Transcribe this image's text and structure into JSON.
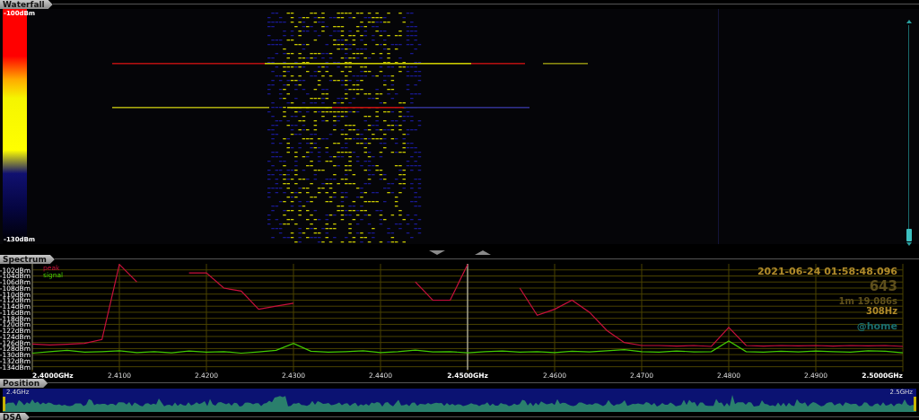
{
  "waterfall": {
    "title": "Waterfall",
    "scale_top": "-100dBm",
    "scale_bottom": "-130dBm"
  },
  "spectrum": {
    "title": "Spectrum",
    "info": [
      {
        "kind": "timestamp",
        "text": "2021-06-24 01:58:48.096"
      },
      {
        "kind": "count",
        "text": "643"
      },
      {
        "kind": "elapsed",
        "text": "1m 19.086s"
      },
      {
        "kind": "resolution",
        "text": "308Hz"
      },
      {
        "kind": "location",
        "text": "@home"
      }
    ],
    "chart_data": {
      "type": "line",
      "x": [
        2.4,
        2.402,
        2.404,
        2.406,
        2.408,
        2.41,
        2.412,
        2.414,
        2.416,
        2.418,
        2.42,
        2.422,
        2.424,
        2.426,
        2.428,
        2.43,
        2.432,
        2.434,
        2.436,
        2.438,
        2.44,
        2.442,
        2.444,
        2.446,
        2.448,
        2.45,
        2.452,
        2.454,
        2.456,
        2.458,
        2.46,
        2.462,
        2.464,
        2.466,
        2.468,
        2.47,
        2.472,
        2.474,
        2.476,
        2.478,
        2.48,
        2.482,
        2.484,
        2.486,
        2.488,
        2.49,
        2.492,
        2.494,
        2.496,
        2.498,
        2.5
      ],
      "series": [
        {
          "name": "peak",
          "color": "#c8103c",
          "values": [
            -126.5,
            -126.8,
            -126.6,
            -126.3,
            -125,
            -100.2,
            -106,
            null,
            null,
            -103,
            -103,
            -108,
            -109,
            -115,
            -114,
            -113,
            null,
            null,
            null,
            null,
            null,
            null,
            -106,
            -112,
            -112,
            -100.2,
            null,
            null,
            -108,
            -117,
            -115,
            -112,
            -116,
            -122,
            -126,
            -127,
            -127,
            -127.2,
            -127,
            -127.3,
            -121,
            -127,
            -127.2,
            -127,
            -127.1,
            -127,
            -127.2,
            -127,
            -127.1,
            -127,
            -127.3
          ]
        },
        {
          "name": "signal",
          "color": "#44cc00",
          "values": [
            -129.5,
            -129,
            -128.6,
            -129.2,
            -129,
            -128.7,
            -129.3,
            -129,
            -129.4,
            -128.8,
            -129.2,
            -129,
            -129.5,
            -129.1,
            -128.6,
            -126.3,
            -128.9,
            -129.2,
            -129,
            -128.7,
            -129.3,
            -129,
            -128.5,
            -129.1,
            -129,
            -129.4,
            -129,
            -128.8,
            -129.2,
            -129,
            -129.3,
            -128.9,
            -129.1,
            -128.7,
            -128.4,
            -129,
            -129.2,
            -128.8,
            -129.1,
            -129,
            -125.5,
            -129,
            -129.2,
            -128.9,
            -129.1,
            -128.8,
            -129,
            -129.2,
            -128.7,
            -128.9,
            -129.4
          ]
        }
      ],
      "xlim": [
        2.4,
        2.5
      ],
      "ylim": [
        -135,
        -100
      ],
      "xticks": [
        {
          "value": 2.4,
          "label": "2.4000GHz"
        },
        {
          "value": 2.41,
          "label": "2.4100"
        },
        {
          "value": 2.42,
          "label": "2.4200"
        },
        {
          "value": 2.43,
          "label": "2.4300"
        },
        {
          "value": 2.44,
          "label": "2.4400"
        },
        {
          "value": 2.45,
          "label": "2.4500GHz"
        },
        {
          "value": 2.46,
          "label": "2.4600"
        },
        {
          "value": 2.47,
          "label": "2.4700"
        },
        {
          "value": 2.48,
          "label": "2.4800"
        },
        {
          "value": 2.49,
          "label": "2.4900"
        },
        {
          "value": 2.5,
          "label": "2.5000GHz"
        }
      ],
      "yticks": [
        {
          "value": -102,
          "label": "-102dBm"
        },
        {
          "value": -104,
          "label": "-104dBm"
        },
        {
          "value": -106,
          "label": "-106dBm"
        },
        {
          "value": -108,
          "label": "-108dBm"
        },
        {
          "value": -110,
          "label": "-110dBm"
        },
        {
          "value": -112,
          "label": "-112dBm"
        },
        {
          "value": -114,
          "label": "-114dBm"
        },
        {
          "value": -116,
          "label": "-116dBm"
        },
        {
          "value": -118,
          "label": "-118dBm"
        },
        {
          "value": -120,
          "label": "-120dBm"
        },
        {
          "value": -122,
          "label": "-122dBm"
        },
        {
          "value": -124,
          "label": "-124dBm"
        },
        {
          "value": -126,
          "label": "-126dBm"
        },
        {
          "value": -128,
          "label": "-128dBm"
        },
        {
          "value": -130,
          "label": "-130dBm"
        },
        {
          "value": -132,
          "label": "-132dBm"
        },
        {
          "value": -134,
          "label": "-134dBm"
        }
      ],
      "grid": true,
      "ref_lines": [
        {
          "axis": "x",
          "value": 2.45,
          "color": "#d8d8d8"
        }
      ]
    }
  },
  "position": {
    "title": "Position",
    "start": "2.4GHz",
    "end": "2.5GHz"
  },
  "dsa": {
    "title": "DSA"
  }
}
